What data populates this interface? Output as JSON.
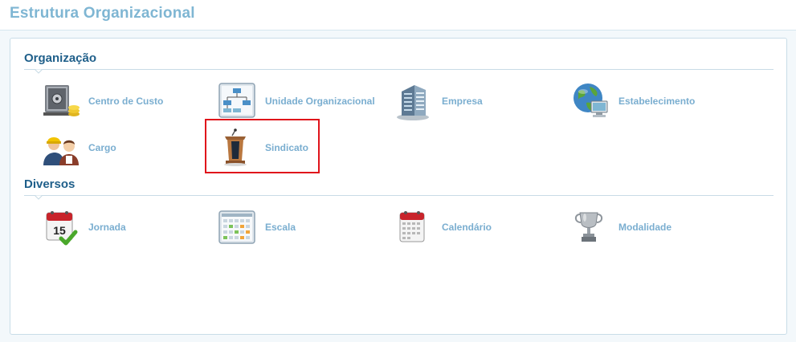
{
  "header": {
    "title": "Estrutura Organizacional"
  },
  "sections": [
    {
      "title": "Organização",
      "items": [
        {
          "label": "Centro de Custo",
          "icon": "safe-icon"
        },
        {
          "label": "Unidade Organizacional",
          "icon": "org-chart-icon"
        },
        {
          "label": "Empresa",
          "icon": "building-icon"
        },
        {
          "label": "Estabelecimento",
          "icon": "globe-computer-icon"
        },
        {
          "label": "Cargo",
          "icon": "workers-icon"
        },
        {
          "label": "Sindicato",
          "icon": "podium-icon"
        }
      ]
    },
    {
      "title": "Diversos",
      "items": [
        {
          "label": "Jornada",
          "icon": "calendar-check-icon"
        },
        {
          "label": "Escala",
          "icon": "schedule-grid-icon"
        },
        {
          "label": "Calendário",
          "icon": "calendar-icon"
        },
        {
          "label": "Modalidade",
          "icon": "trophy-icon"
        }
      ]
    }
  ],
  "colors": {
    "title": "#7fb6d3",
    "section_title": "#1f5f8a",
    "item_label": "#7aaed0",
    "highlight": "#e0141b"
  }
}
